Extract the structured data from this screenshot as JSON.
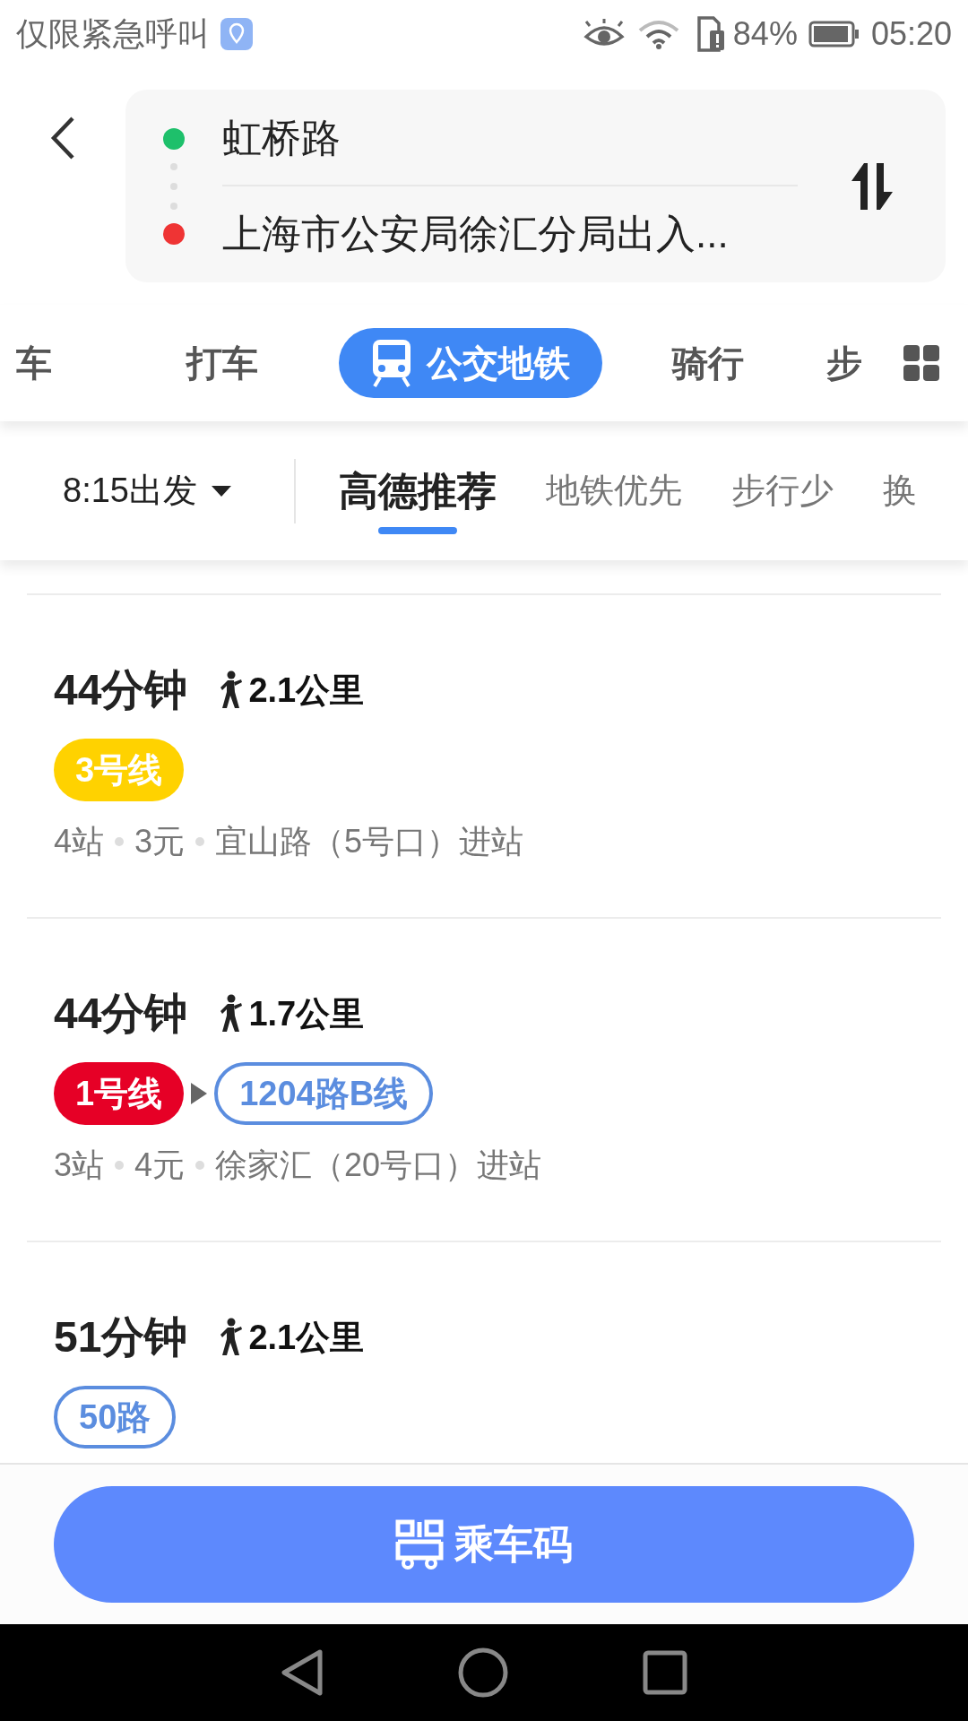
{
  "status_bar": {
    "carrier": "仅限紧急呼叫",
    "battery": "84%",
    "time": "05:20"
  },
  "route_input": {
    "origin": "虹桥路",
    "destination": "上海市公安局徐汇分局出入..."
  },
  "modes": [
    {
      "label": "车",
      "kind": "text",
      "selected": false
    },
    {
      "label": "打车",
      "kind": "text",
      "selected": false
    },
    {
      "label": "公交地铁",
      "kind": "transit",
      "selected": true
    },
    {
      "label": "骑行",
      "kind": "text",
      "selected": false
    },
    {
      "label": "步",
      "kind": "text",
      "selected": false
    }
  ],
  "departure": "8:15出发",
  "sort_options": [
    {
      "label": "高德推荐",
      "selected": true
    },
    {
      "label": "地铁优先",
      "selected": false
    },
    {
      "label": "步行少",
      "selected": false
    },
    {
      "label": "换",
      "selected": false
    }
  ],
  "routes": [
    {
      "duration": "44分钟",
      "walk": "2.1公里",
      "segments": [
        {
          "label": "3号线",
          "kind": "subway",
          "color": "#ffd200"
        }
      ],
      "info": [
        "4站",
        "3元",
        "宜山路（5号口）进站"
      ]
    },
    {
      "duration": "44分钟",
      "walk": "1.7公里",
      "segments": [
        {
          "label": "1号线",
          "kind": "subway",
          "color": "#e60026"
        },
        {
          "label": "1204路B线",
          "kind": "bus",
          "color": "#5b8ddf"
        }
      ],
      "info": [
        "3站",
        "4元",
        "徐家汇（20号口）进站"
      ]
    },
    {
      "duration": "51分钟",
      "walk": "2.1公里",
      "segments": [
        {
          "label": "50路",
          "kind": "bus",
          "color": "#5b8ddf"
        }
      ]
    }
  ],
  "ride_code_button": "乘车码"
}
